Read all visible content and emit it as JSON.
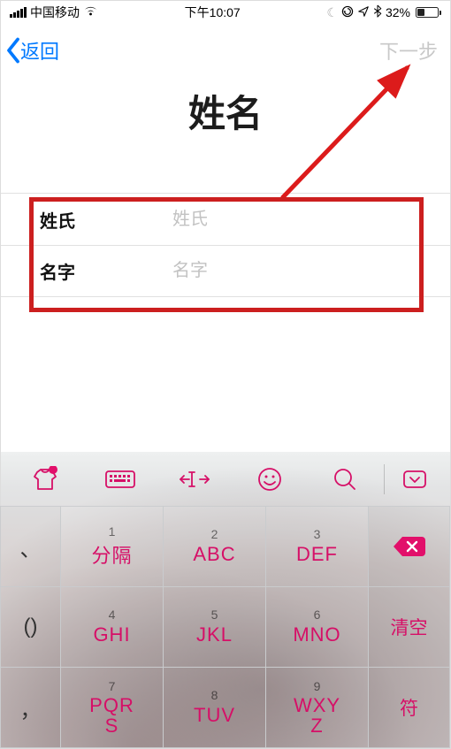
{
  "status": {
    "carrier": "中国移动",
    "time": "下午10:07",
    "battery_percent": "32%"
  },
  "nav": {
    "back": "返回",
    "next": "下一步"
  },
  "title": "姓名",
  "form": {
    "lastname_label": "姓氏",
    "lastname_placeholder": "姓氏",
    "lastname_value": "",
    "firstname_label": "名字",
    "firstname_placeholder": "名字",
    "firstname_value": ""
  },
  "keyboard": {
    "toolbar_icons": [
      "shirt-icon",
      "keyboard-icon",
      "cursor-icon",
      "smiley-icon",
      "search-icon",
      "collapse-icon"
    ],
    "side_keys": [
      "、",
      "()",
      "，"
    ],
    "keys": [
      {
        "num": "1",
        "main": "分隔"
      },
      {
        "num": "2",
        "main": "ABC"
      },
      {
        "num": "3",
        "main": "DEF"
      },
      {
        "num": "4",
        "main": "GHI"
      },
      {
        "num": "5",
        "main": "JKL"
      },
      {
        "num": "6",
        "main": "MNO"
      },
      {
        "num": "7",
        "main": "PQR\nS"
      },
      {
        "num": "8",
        "main": "TUV"
      },
      {
        "num": "9",
        "main": "WXY\nZ"
      }
    ],
    "edge_keys": {
      "clear": "清空",
      "symbol": "符"
    }
  }
}
